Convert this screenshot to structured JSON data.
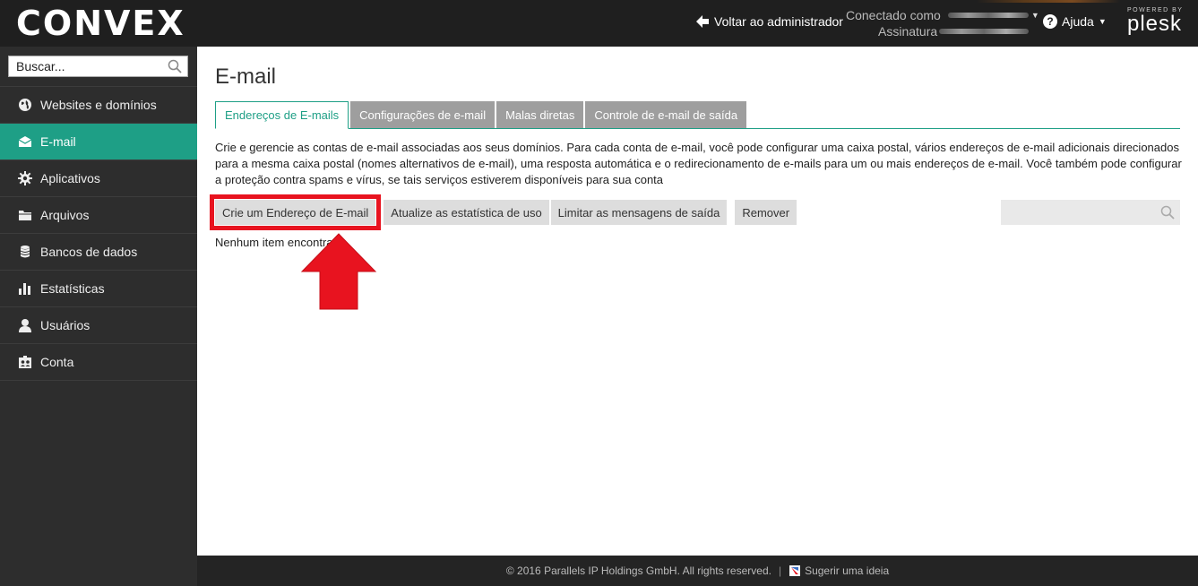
{
  "topbar": {
    "logo": "CONVEX",
    "back_label": "Voltar ao administrador",
    "connected_label": "Conectado como",
    "subscription_label": "Assinatura",
    "help_label": "Ajuda",
    "powered_by": "POWERED BY",
    "plesk": "plesk"
  },
  "sidebar": {
    "search_placeholder": "Buscar...",
    "items": [
      {
        "label": "Websites e domínios",
        "icon": "globe-icon"
      },
      {
        "label": "E-mail",
        "icon": "envelope-icon",
        "active": true
      },
      {
        "label": "Aplicativos",
        "icon": "gear-icon"
      },
      {
        "label": "Arquivos",
        "icon": "folder-icon"
      },
      {
        "label": "Bancos de dados",
        "icon": "database-icon"
      },
      {
        "label": "Estatísticas",
        "icon": "bar-chart-icon"
      },
      {
        "label": "Usuários",
        "icon": "user-icon"
      },
      {
        "label": "Conta",
        "icon": "id-card-icon"
      }
    ]
  },
  "main": {
    "title": "E-mail",
    "tabs": [
      {
        "label": "Endereços de E-mails",
        "active": true
      },
      {
        "label": "Configurações de e-mail"
      },
      {
        "label": "Malas diretas"
      },
      {
        "label": "Controle de e-mail de saída"
      }
    ],
    "description": "Crie e gerencie as contas de e-mail associadas aos seus domínios. Para cada conta de e-mail, você pode configurar uma caixa postal, vários endereços de e-mail adicionais direcionados para a mesma caixa postal (nomes alternativos de e-mail), uma resposta automática e o redirecionamento de e-mails para um ou mais endereços de e-mail. Você também pode configurar a proteção contra spams e vírus, se tais serviços estiverem disponíveis para sua conta",
    "buttons": {
      "create": "Crie um Endereço de E-mail",
      "update_stats": "Atualize as estatística de uso",
      "limit": "Limitar as mensagens de saída",
      "remove": "Remover"
    },
    "empty_text": "Nenhum item encontrado."
  },
  "footer": {
    "copyright": "© 2016 Parallels IP Holdings GmbH. All rights reserved.",
    "separator": "|",
    "suggest": "Sugerir uma ideia"
  },
  "colors": {
    "accent": "#1e9f86",
    "highlight": "#e8131f",
    "topbar": "#1f1f1f",
    "sidebar": "#2d2d2d"
  }
}
